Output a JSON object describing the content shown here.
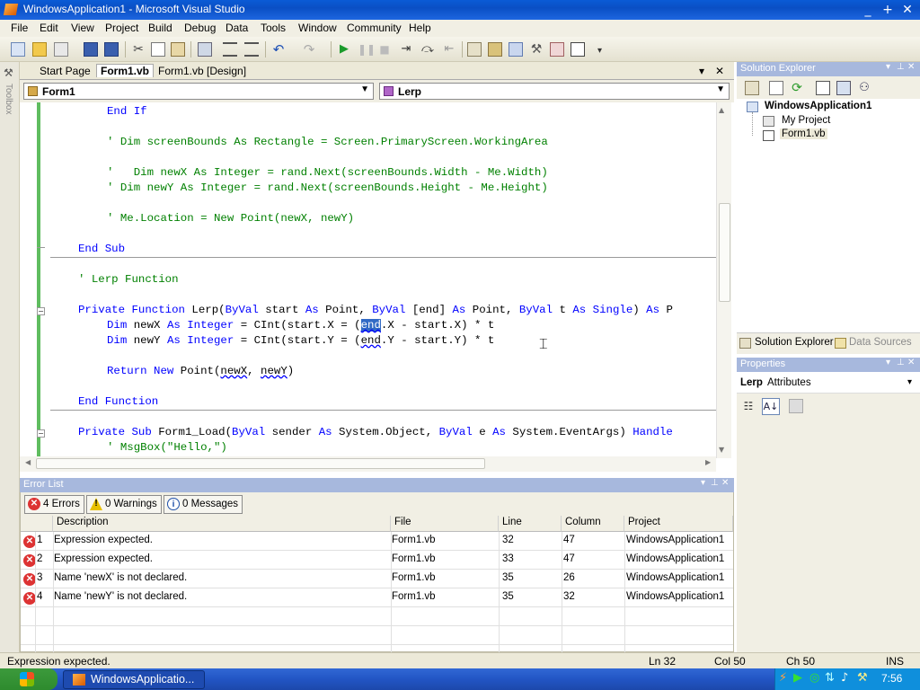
{
  "window": {
    "title": "WindowsApplication1 - Microsoft Visual Studio",
    "min": "_",
    "max": "+",
    "close": "✕"
  },
  "menu": [
    "File",
    "Edit",
    "View",
    "Project",
    "Build",
    "Debug",
    "Data",
    "Tools",
    "Window",
    "Community",
    "Help"
  ],
  "toolbox": {
    "label": "Toolbox"
  },
  "tabs": {
    "start": "Start Page",
    "form1vb": "Form1.vb",
    "design": "Form1.vb [Design]",
    "dropdown_icon": "▾",
    "close": "✕"
  },
  "nav": {
    "class": "Form1",
    "method": "Lerp"
  },
  "code": {
    "l1": "End If",
    "l2": "' Dim screenBounds As Rectangle = Screen.PrimaryScreen.WorkingArea",
    "l3": "'   Dim newX As Integer = rand.Next(screenBounds.Width - Me.Width)",
    "l4": "' Dim newY As Integer = rand.Next(screenBounds.Height - Me.Height)",
    "l5": "' Me.Location = New Point(newX, newY)",
    "l6": "End Sub",
    "l7": "' Lerp Function",
    "l8a": "Private Function",
    "l8b": " Lerp(",
    "l8c": "ByVal",
    "l8d": " start ",
    "l8e": "As",
    "l8f": " Point, ",
    "l8g": "ByVal",
    "l8h": " [end] ",
    "l8i": "As",
    "l8j": " Point, ",
    "l8k": "ByVal",
    "l8l": " t ",
    "l8m": "As",
    "l8n": " Single",
    "l8o": ")",
    "l8p": " As",
    "l8q": " P",
    "l9a": "Dim",
    "l9b": " newX ",
    "l9c": "As Integer",
    "l9d": " = CInt(start.X = (",
    "l9e": "end",
    "l9f": ".X - start.X) * t",
    "l10a": "Dim",
    "l10b": " newY ",
    "l10c": "As Integer",
    "l10d": " = CInt(start.Y = (",
    "l10e": "end",
    "l10f": ".Y - start.Y) * t",
    "l11a": "Return New",
    "l11b": " Point(",
    "l11c": "newX",
    "l11d": ", ",
    "l11e": "newY",
    "l11f": ")",
    "l12": "End Function",
    "l13a": "Private Sub",
    "l13b": " Form1_Load(",
    "l13c": "ByVal",
    "l13d": " sender ",
    "l13e": "As",
    "l13f": " System.Object, ",
    "l13g": "ByVal",
    "l13h": " e ",
    "l13i": "As",
    "l13j": " System.EventArgs) ",
    "l13k": "Handle",
    "l14": "' MsgBox(\"Hello,\")"
  },
  "errorlist": {
    "title": "Error List",
    "errors": "4 Errors",
    "warnings": "0 Warnings",
    "messages": "0 Messages",
    "cols": {
      "description": "Description",
      "file": "File",
      "line": "Line",
      "column": "Column",
      "project": "Project"
    },
    "rows": [
      {
        "n": "1",
        "desc": "Expression expected.",
        "file": "Form1.vb",
        "line": "32",
        "col": "47",
        "proj": "WindowsApplication1"
      },
      {
        "n": "2",
        "desc": "Expression expected.",
        "file": "Form1.vb",
        "line": "33",
        "col": "47",
        "proj": "WindowsApplication1"
      },
      {
        "n": "3",
        "desc": "Name 'newX' is not declared.",
        "file": "Form1.vb",
        "line": "35",
        "col": "26",
        "proj": "WindowsApplication1"
      },
      {
        "n": "4",
        "desc": "Name 'newY' is not declared.",
        "file": "Form1.vb",
        "line": "35",
        "col": "32",
        "proj": "WindowsApplication1"
      }
    ]
  },
  "solution": {
    "title": "Solution Explorer",
    "root": "WindowsApplication1",
    "project": "My Project",
    "file": "Form1.vb",
    "tab1": "Solution Explorer",
    "tab2": "Data Sources"
  },
  "properties": {
    "title": "Properties",
    "object": "Lerp",
    "type": "Attributes"
  },
  "status": {
    "message": "Expression expected.",
    "ln": "Ln 32",
    "col": "Col 50",
    "ch": "Ch 50",
    "mode": "INS"
  },
  "taskbar": {
    "app": "WindowsApplicatio...",
    "time": "7:56"
  },
  "colors": {
    "keyword": "#0000ff",
    "comment": "#008000",
    "selection": "#316ac5",
    "titlebar": "#0a5bd6"
  }
}
